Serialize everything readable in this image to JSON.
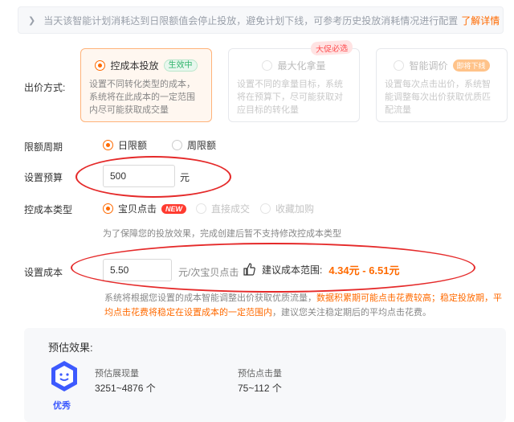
{
  "notice": {
    "text": "当天该智能计划消耗达到日限额值会停止投放，避免计划下线，可参考历史投放消耗情况进行配置",
    "link": "了解详情 >"
  },
  "bid_method": {
    "label": "出价方式:",
    "cards": [
      {
        "title": "控成本投放",
        "badge": "生效中",
        "desc": "设置不同转化类型的成本，系统将在此成本的一定范围内尽可能获取成交量"
      },
      {
        "title": "最大化拿量",
        "badge": "大促必选",
        "desc": "设置不同的拿量目标，系统将在预算下，尽可能获取对应目标的转化量"
      },
      {
        "title": "智能调价",
        "badge": "即将下线",
        "desc": "设置每次点击出价，系统智能调整每次出价获取优质匹配流量"
      }
    ]
  },
  "budget_period": {
    "label": "限额周期",
    "options": [
      "日限额",
      "周限额"
    ],
    "selected": "日限额"
  },
  "budget": {
    "label": "设置预算",
    "value": "500",
    "unit": "元"
  },
  "cost_type": {
    "label": "控成本类型",
    "options": [
      "宝贝点击",
      "直接成交",
      "收藏加购"
    ],
    "new_badge": "NEW",
    "hint": "为了保障您的投放效果，完成创建后暂不支持修改控成本类型"
  },
  "cost": {
    "label": "设置成本",
    "value": "5.50",
    "unit": "元/次宝贝点击",
    "suggest_label": "建议成本范围:",
    "suggest_range": "4.34元 - 6.51元"
  },
  "note": {
    "plain1": "系统将根据您设置的成本智能调整出价获取优质流量，",
    "hl": "数据积累期可能点击花费较高；稳定投放期，平均点击花费将稳定在设置成本的一定范围内",
    "plain2": "，建议您关注稳定期后的平均点击花费。"
  },
  "estimate": {
    "title": "预估效果:",
    "rating": "优秀",
    "impressions_label": "预估展现量",
    "impressions_value": "3251~4876 个",
    "clicks_label": "预估点击量",
    "clicks_value": "75~112 个"
  },
  "colors": {
    "accent": "#ff6a00",
    "annotation": "#e52a2a",
    "rating": "#3d5afe"
  }
}
